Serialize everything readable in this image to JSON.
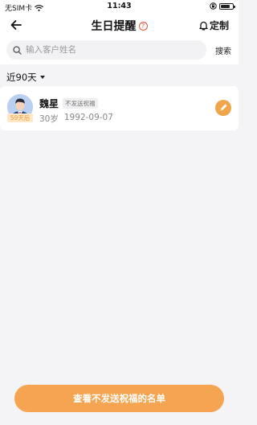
{
  "status_bar": {
    "carrier": "无SIM卡",
    "time": "11:43",
    "battery_level": 0.8,
    "icons": [
      "wifi-icon",
      "lock-rotation-icon",
      "battery-icon"
    ]
  },
  "header": {
    "title": "生日提醒",
    "help_symbol": "?",
    "customize_label": "定制",
    "icons": [
      "back-arrow-icon",
      "help-icon",
      "bell-icon"
    ]
  },
  "search": {
    "placeholder": "输入客户姓名",
    "value": "",
    "button_label": "搜索"
  },
  "filter": {
    "label": "近90天"
  },
  "customers": [
    {
      "days_until": "59天后",
      "name": "魏星",
      "tag": "不发送祝福",
      "age": "30岁",
      "birthday": "1992-09-07"
    }
  ],
  "footer": {
    "button_label": "查看不发送祝福的名单"
  },
  "colors": {
    "accent": "#f5a451",
    "help_red": "#e8553a",
    "badge_bg": "#ffe7c8",
    "badge_text": "#f19a2f"
  }
}
